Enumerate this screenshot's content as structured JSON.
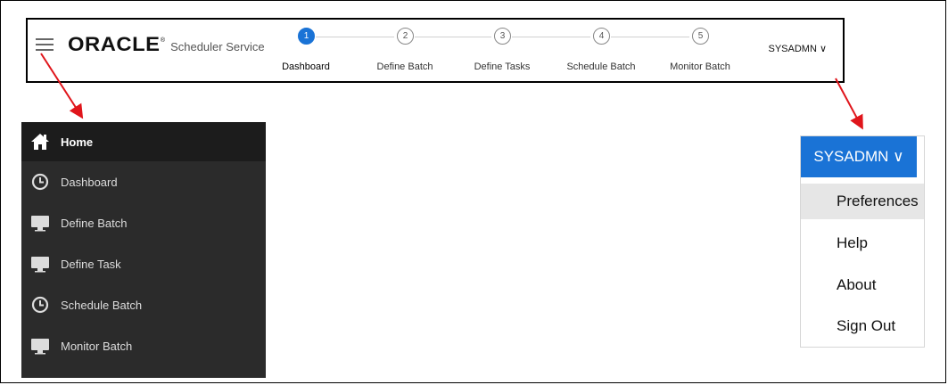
{
  "header": {
    "brand_logo": "ORACLE",
    "brand_registered": "®",
    "brand_subtitle": "Scheduler Service",
    "user_label": "SYSADMN ∨"
  },
  "stepper": [
    {
      "number": "1",
      "label": "Dashboard",
      "active": true
    },
    {
      "number": "2",
      "label": "Define Batch",
      "active": false
    },
    {
      "number": "3",
      "label": "Define Tasks",
      "active": false
    },
    {
      "number": "4",
      "label": "Schedule Batch",
      "active": false
    },
    {
      "number": "5",
      "label": "Monitor Batch",
      "active": false
    }
  ],
  "sidebar": {
    "items": [
      {
        "label": "Home",
        "icon": "home-icon"
      },
      {
        "label": "Dashboard",
        "icon": "clock-icon"
      },
      {
        "label": "Define Batch",
        "icon": "monitor-icon"
      },
      {
        "label": "Define Task",
        "icon": "monitor-icon"
      },
      {
        "label": "Schedule Batch",
        "icon": "clock-icon"
      },
      {
        "label": "Monitor Batch",
        "icon": "monitor-icon"
      }
    ]
  },
  "user_dropdown": {
    "button_label": "SYSADMN ∨",
    "items": [
      "Preferences",
      "Help",
      "About",
      "Sign Out"
    ]
  },
  "colors": {
    "accent": "#1a73d6",
    "sidebar_bg": "#2b2b2b",
    "sidebar_active_bg": "#1c1c1c",
    "arrow": "#e0151b"
  }
}
